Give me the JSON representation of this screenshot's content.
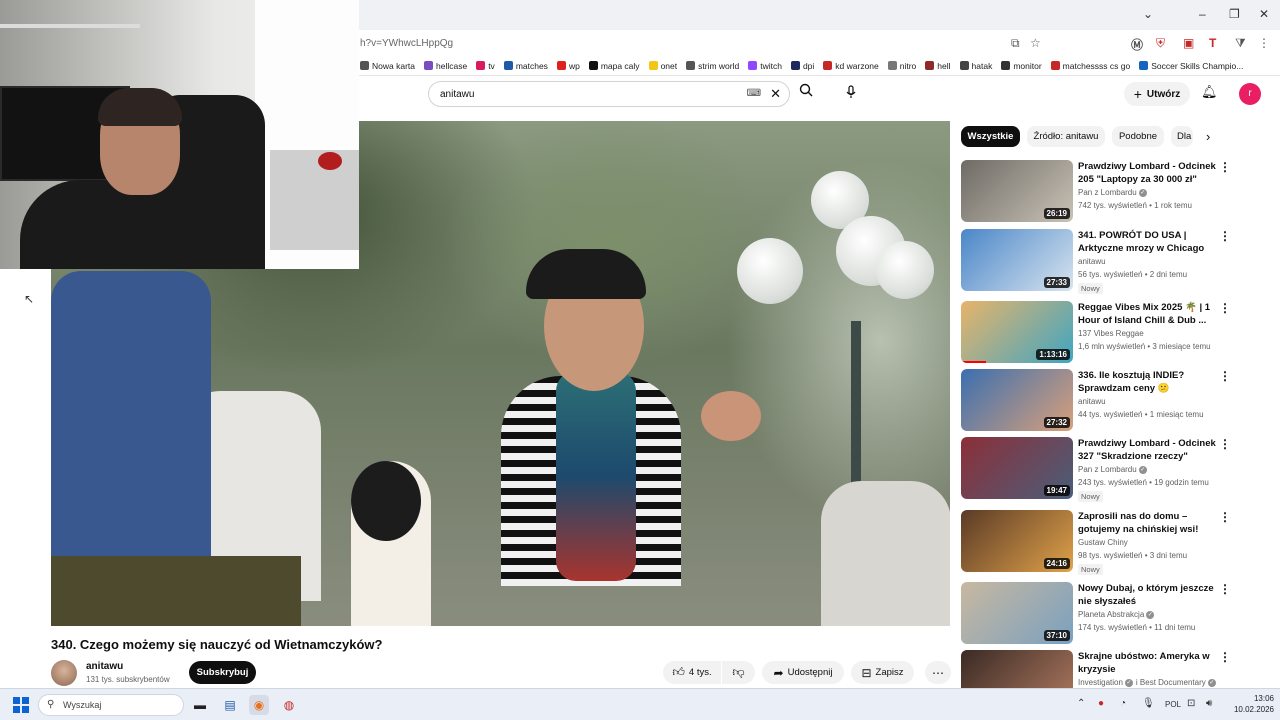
{
  "browser": {
    "url": "h?v=YWhwcLHppQg",
    "window_controls": [
      "⌄",
      "–",
      "❐",
      "✕"
    ],
    "bookmarks": [
      {
        "label": "Nowa karta",
        "color": "#555555"
      },
      {
        "label": "hellcase",
        "color": "#7a4cc2"
      },
      {
        "label": "tv",
        "color": "#d81b60"
      },
      {
        "label": "matches",
        "color": "#1e5aa8"
      },
      {
        "label": "wp",
        "color": "#e0201b"
      },
      {
        "label": "mapa caly",
        "color": "#111111"
      },
      {
        "label": "onet",
        "color": "#f3c515"
      },
      {
        "label": "strim world",
        "color": "#555555"
      },
      {
        "label": "twitch",
        "color": "#9146ff"
      },
      {
        "label": "dpi",
        "color": "#1c2a5c"
      },
      {
        "label": "kd warzone",
        "color": "#c62828"
      },
      {
        "label": "nitro",
        "color": "#777777"
      },
      {
        "label": "hell",
        "color": "#8d2b2b"
      },
      {
        "label": "hatak",
        "color": "#444444"
      },
      {
        "label": "monitor",
        "color": "#333333"
      },
      {
        "label": "matchessss cs go",
        "color": "#c62828"
      },
      {
        "label": "Soccer Skills Champio...",
        "color": "#1565c0"
      }
    ]
  },
  "header": {
    "search_query": "anitawu",
    "create_label": "Utwórz",
    "avatar_letter": "r"
  },
  "video": {
    "title": "340. Czego możemy się nauczyć od Wietnamczyków?",
    "channel": "anitawu",
    "subscribers": "131 tys. subskrybentów",
    "subscribe_label": "Subskrybuj",
    "likes": "4 tys.",
    "share_label": "Udostępnij",
    "save_label": "Zapisz"
  },
  "chips": [
    "Wszystkie",
    "Źródło: anitawu",
    "Podobne",
    "Dla"
  ],
  "recommendations": [
    {
      "title": "Prawdziwy Lombard - Odcinek 205 \"Laptopy za 30 000 zł\"",
      "channel": "Pan z Lombardu",
      "verified": true,
      "meta": "742 tys. wyświetleń • 1 rok temu",
      "duration": "26:19",
      "badge": "",
      "colors": [
        "#6e6b65",
        "#c9c2b6"
      ]
    },
    {
      "title": "341. POWRÓT DO USA | Arktyczne mrozy w Chicago",
      "channel": "anitawu",
      "verified": false,
      "meta": "56 tys. wyświetleń • 2 dni temu",
      "duration": "27:33",
      "badge": "Nowy",
      "colors": [
        "#4a86c8",
        "#d8e4ef"
      ]
    },
    {
      "title": "Reggae Vibes Mix 2025 🌴 | 1 Hour of Island Chill & Dub ...",
      "channel": "137 Vibes Reggae",
      "verified": false,
      "meta": "1,6 mln wyświetleń • 3 miesiące temu",
      "duration": "1:13:16",
      "badge": "",
      "colors": [
        "#e8b46a",
        "#3fa5c2"
      ]
    },
    {
      "title": "336. Ile kosztują INDIE? Sprawdzam ceny 😕",
      "channel": "anitawu",
      "verified": false,
      "meta": "44 tys. wyświetleń • 1 miesiąc temu",
      "duration": "27:32",
      "badge": "",
      "colors": [
        "#3b6fb0",
        "#d9a07a"
      ]
    },
    {
      "title": "Prawdziwy Lombard - Odcinek 327 \"Skradzione rzeczy\"",
      "channel": "Pan z Lombardu",
      "verified": true,
      "meta": "243 tys. wyświetleń • 19 godzin temu",
      "duration": "19:47",
      "badge": "Nowy",
      "colors": [
        "#8c2f39",
        "#4a5e7a"
      ]
    },
    {
      "title": "Zaprosili nas do domu – gotujemy na chińskiej wsi!",
      "channel": "Gustaw Chiny",
      "verified": false,
      "meta": "98 tys. wyświetleń • 3 dni temu",
      "duration": "24:16",
      "badge": "Nowy",
      "colors": [
        "#5a3a26",
        "#e0a24a"
      ]
    },
    {
      "title": "Nowy Dubaj, o którym jeszcze nie słyszałeś",
      "channel": "Planeta Abstrakcja",
      "verified": true,
      "meta": "174 tys. wyświetleń • 11 dni temu",
      "duration": "37:10",
      "badge": "",
      "colors": [
        "#c8b8a0",
        "#7aa0c0"
      ]
    },
    {
      "title": "Skrajne ubóstwo: Ameryka w kryzysie",
      "channel": "Investigation",
      "channel_extra": "i Best Documentary",
      "verified": true,
      "meta": "",
      "duration": "",
      "badge": "",
      "colors": [
        "#3a2a24",
        "#b07a60"
      ]
    }
  ],
  "taskbar": {
    "search_placeholder": "Wyszukaj",
    "lang": "POL",
    "time": "13:06",
    "date": "10.02.2026"
  }
}
